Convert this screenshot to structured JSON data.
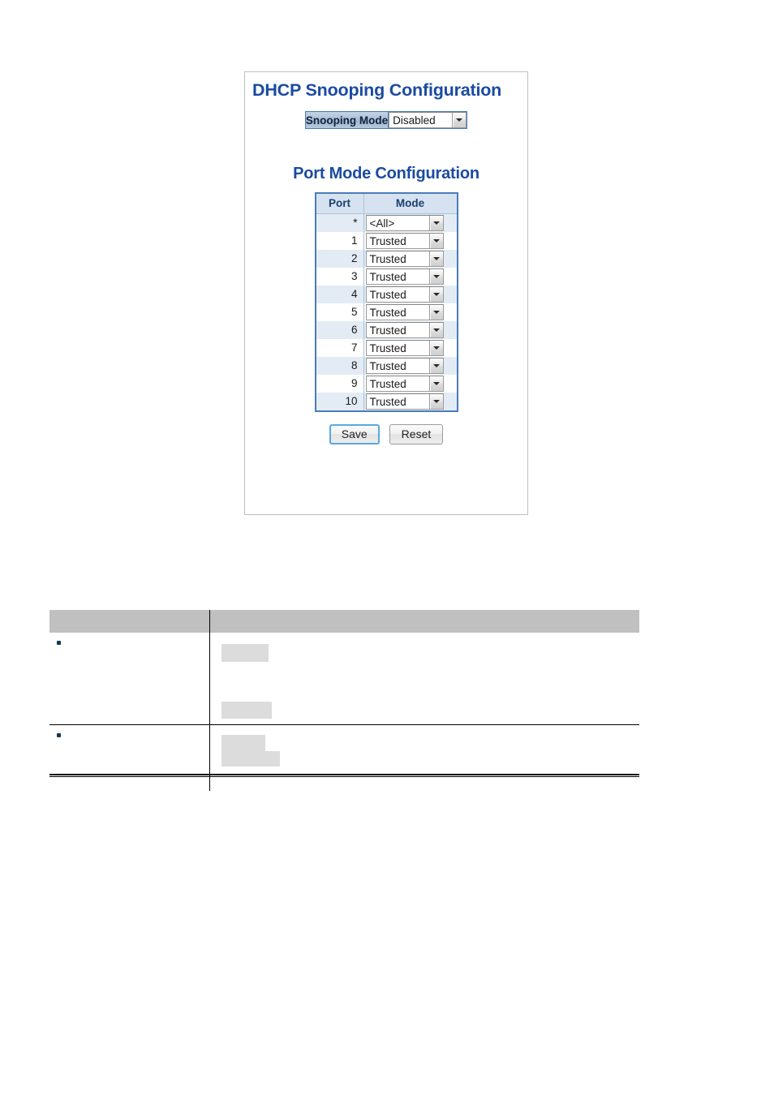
{
  "panel": {
    "title": "DHCP Snooping Configuration",
    "snooping_mode": {
      "label": "Snooping Mode",
      "value": "Disabled",
      "dropdown_icon": "chevron-down-icon"
    },
    "port_mode": {
      "subtitle": "Port Mode Configuration",
      "columns": [
        "Port",
        "Mode"
      ],
      "rows": [
        {
          "port": "*",
          "mode": "<All>"
        },
        {
          "port": "1",
          "mode": "Trusted"
        },
        {
          "port": "2",
          "mode": "Trusted"
        },
        {
          "port": "3",
          "mode": "Trusted"
        },
        {
          "port": "4",
          "mode": "Trusted"
        },
        {
          "port": "5",
          "mode": "Trusted"
        },
        {
          "port": "6",
          "mode": "Trusted"
        },
        {
          "port": "7",
          "mode": "Trusted"
        },
        {
          "port": "8",
          "mode": "Trusted"
        },
        {
          "port": "9",
          "mode": "Trusted"
        },
        {
          "port": "10",
          "mode": "Trusted"
        }
      ]
    },
    "buttons": {
      "save": "Save",
      "reset": "Reset"
    }
  },
  "description_table": {
    "header": {
      "col1": "",
      "col2": ""
    },
    "rows": [
      {
        "bullet": "▪",
        "label": "",
        "description": ""
      },
      {
        "bullet": "▪",
        "label": "",
        "description": ""
      }
    ]
  },
  "colors": {
    "heading_blue": "#1b4ba0",
    "table_border_blue": "#4a7cb8",
    "table_header_bg": "#d6e2ef",
    "row_alt_bg": "#e3ecf5",
    "redaction_gray": "#dcdcdc",
    "desc_header_gray": "#c0c0c0",
    "bullet_navy": "#16384f"
  }
}
